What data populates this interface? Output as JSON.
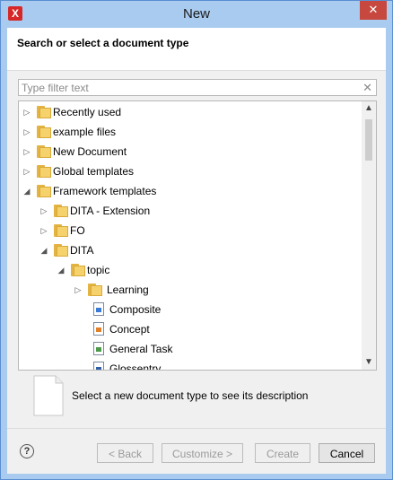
{
  "window": {
    "title": "New",
    "close_glyph": "✕",
    "app_icon_letter": "X"
  },
  "header": {
    "title": "Search or select a document type"
  },
  "filter": {
    "placeholder": "Type filter text",
    "value": "",
    "clear_glyph": "✕"
  },
  "tree": {
    "items": [
      {
        "label": "Recently used",
        "level": 0,
        "expanded": false,
        "type": "folder"
      },
      {
        "label": "example files",
        "level": 0,
        "expanded": false,
        "type": "folder"
      },
      {
        "label": "New Document",
        "level": 0,
        "expanded": false,
        "type": "folder"
      },
      {
        "label": "Global templates",
        "level": 0,
        "expanded": false,
        "type": "folder"
      },
      {
        "label": "Framework templates",
        "level": 0,
        "expanded": true,
        "type": "folder"
      },
      {
        "label": "DITA - Extension",
        "level": 1,
        "expanded": false,
        "type": "folder"
      },
      {
        "label": "FO",
        "level": 1,
        "expanded": false,
        "type": "folder"
      },
      {
        "label": "DITA",
        "level": 1,
        "expanded": true,
        "type": "folder"
      },
      {
        "label": "topic",
        "level": 2,
        "expanded": true,
        "type": "folder"
      },
      {
        "label": "Learning",
        "level": 3,
        "expanded": false,
        "type": "folder"
      },
      {
        "label": "Composite",
        "level": 3,
        "type": "doc",
        "icon": "composite-doc-icon"
      },
      {
        "label": "Concept",
        "level": 3,
        "type": "doc",
        "icon": "concept-doc-icon"
      },
      {
        "label": "General Task",
        "level": 3,
        "type": "doc",
        "icon": "task-doc-icon"
      },
      {
        "label": "Glossentry",
        "level": 3,
        "type": "doc",
        "icon": "glossentry-doc-icon"
      }
    ]
  },
  "description": {
    "text": "Select a new document type to see its description"
  },
  "buttons": {
    "help": "?",
    "back": "< Back",
    "customize": "Customize >",
    "create": "Create",
    "cancel": "Cancel"
  }
}
